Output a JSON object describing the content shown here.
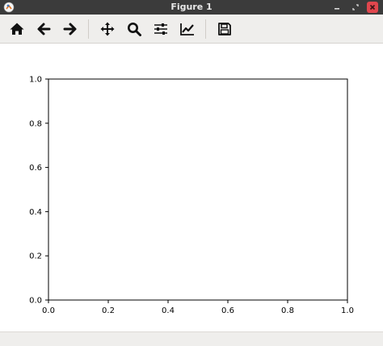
{
  "window": {
    "title": "Figure 1"
  },
  "toolbar": {
    "buttons": [
      {
        "name": "home",
        "icon": "home-icon"
      },
      {
        "name": "back",
        "icon": "arrow-left-icon"
      },
      {
        "name": "forward",
        "icon": "arrow-right-icon"
      },
      {
        "name": "pan",
        "icon": "move-icon"
      },
      {
        "name": "zoom",
        "icon": "search-icon"
      },
      {
        "name": "subplots",
        "icon": "sliders-icon"
      },
      {
        "name": "edit-axes",
        "icon": "line-chart-icon"
      },
      {
        "name": "save",
        "icon": "save-icon"
      }
    ]
  },
  "chart_data": {
    "type": "line",
    "title": "",
    "xlabel": "",
    "ylabel": "",
    "xlim": [
      0.0,
      1.0
    ],
    "ylim": [
      0.0,
      1.0
    ],
    "x_ticks": [
      "0.0",
      "0.2",
      "0.4",
      "0.6",
      "0.8",
      "1.0"
    ],
    "y_ticks": [
      "0.0",
      "0.2",
      "0.4",
      "0.6",
      "0.8",
      "1.0"
    ],
    "series": [],
    "grid": false
  },
  "colors": {
    "titlebar": "#3b3b3b",
    "toolbar": "#efeeec",
    "close": "#e0464d"
  }
}
